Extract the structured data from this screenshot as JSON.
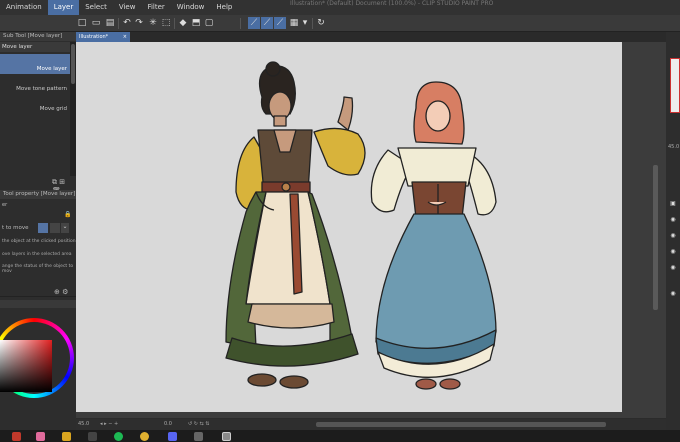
{
  "window": {
    "title": "Illustration* (Default) Document (100.0%) - CLIP STUDIO PAINT PRO"
  },
  "menu": {
    "items": [
      "Animation",
      "Layer",
      "Select",
      "View",
      "Filter",
      "Window",
      "Help"
    ],
    "active": "Layer"
  },
  "sub_tool": {
    "header": "Sub Tool [Move layer]",
    "selected": "Move layer",
    "items": [
      "Move layer",
      "Move tone pattern",
      "Move grid"
    ]
  },
  "tool_property": {
    "header": "Tool property [Move layer]",
    "sub_header": "er",
    "mode_label": "t to move",
    "options": [
      "the object at the clicked position",
      "ove layers in the selected area",
      "ange the status of the object to mov"
    ]
  },
  "canvas": {
    "tab_label": "Illustration*"
  },
  "status": {
    "zoom": "45.0",
    "rotation": "0.0"
  },
  "right_panel": {
    "value": "45.0"
  },
  "colors": {
    "accent": "#4a6ea3",
    "canvas": "#d9d9d9"
  }
}
